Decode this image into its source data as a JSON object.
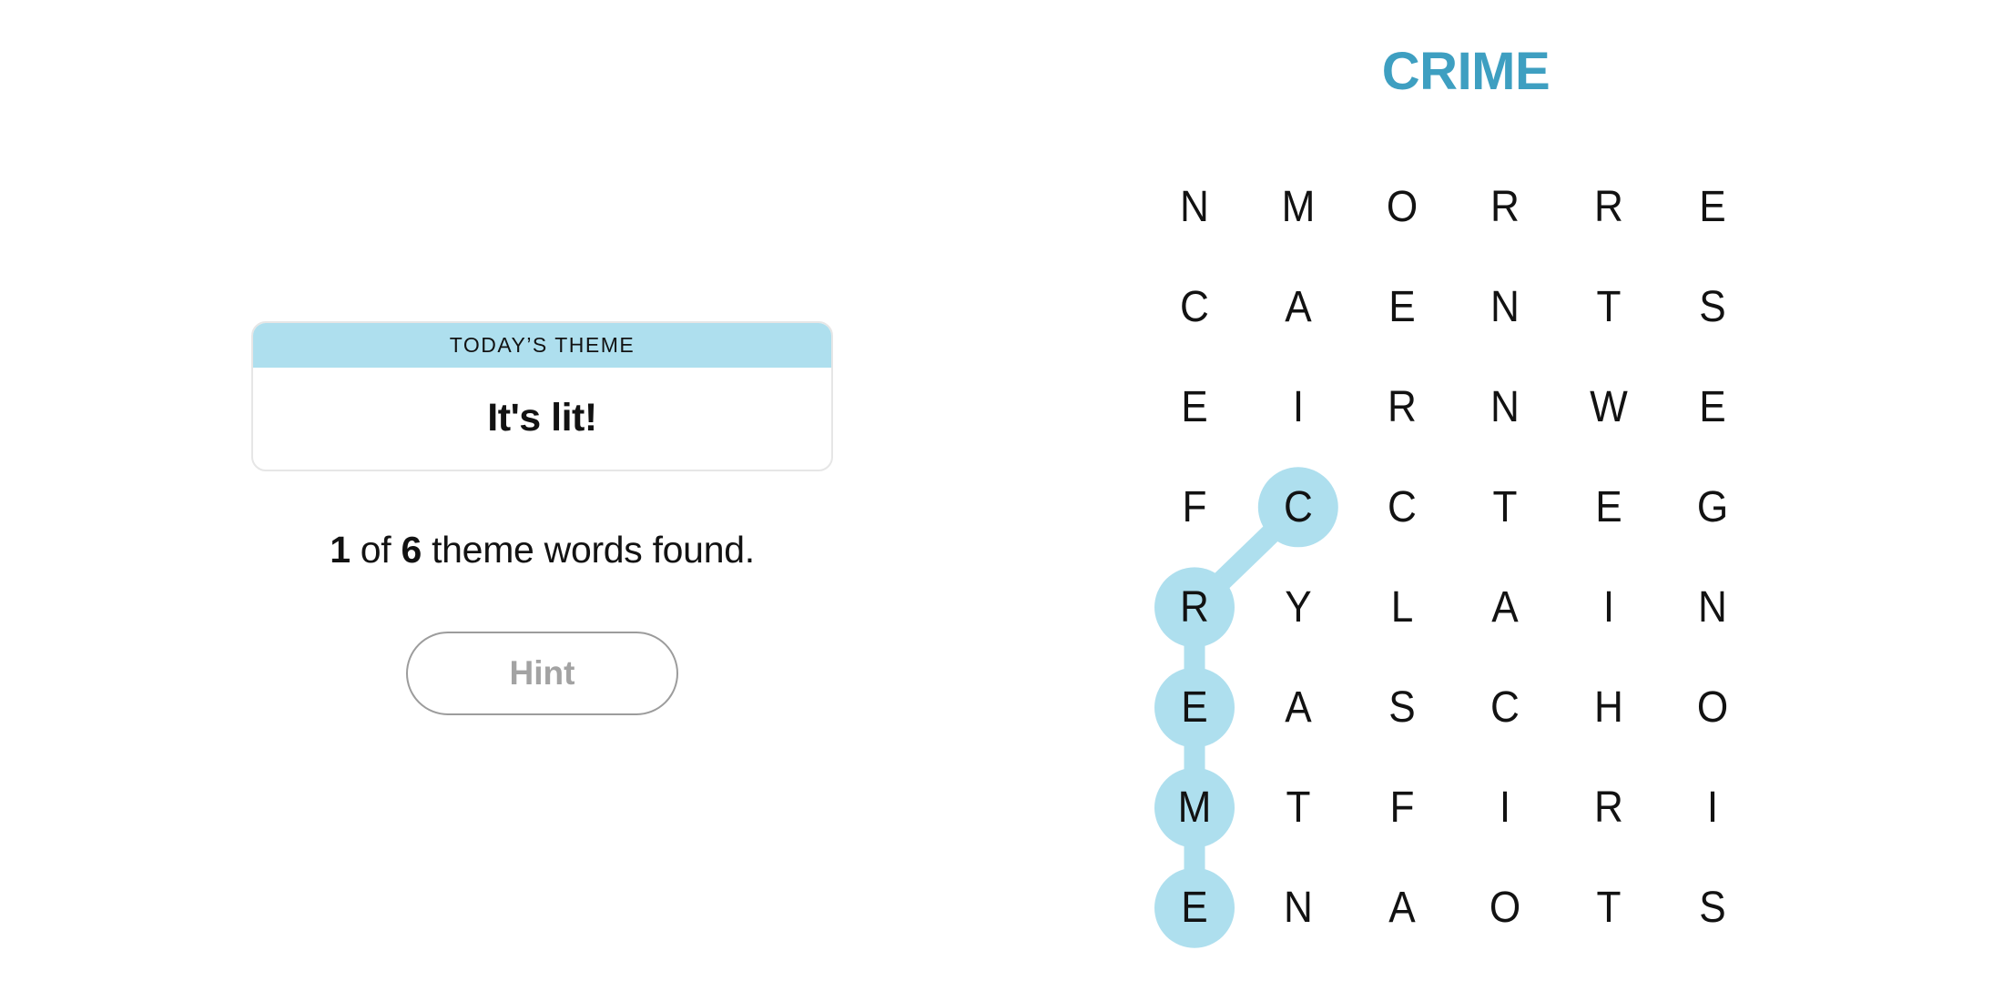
{
  "theme": {
    "header": "TODAY’S THEME",
    "value": "It's lit!"
  },
  "progress": {
    "found": "1",
    "of_label": "of",
    "total": "6",
    "suffix": "theme words found."
  },
  "hint_button": {
    "label": "Hint",
    "state": "disabled"
  },
  "current_word": "CRIME",
  "colors": {
    "highlight": "#aedfee",
    "current_word": "#3e9fc1",
    "hint_text": "#a3a3a3"
  },
  "grid": {
    "rows": [
      [
        "N",
        "M",
        "O",
        "R",
        "R",
        "E"
      ],
      [
        "C",
        "A",
        "E",
        "N",
        "T",
        "S"
      ],
      [
        "E",
        "I",
        "R",
        "N",
        "W",
        "E"
      ],
      [
        "F",
        "C",
        "C",
        "T",
        "E",
        "G"
      ],
      [
        "R",
        "Y",
        "L",
        "A",
        "I",
        "N"
      ],
      [
        "E",
        "A",
        "S",
        "C",
        "H",
        "O"
      ],
      [
        "M",
        "T",
        "F",
        "I",
        "R",
        "I"
      ],
      [
        "E",
        "N",
        "A",
        "O",
        "T",
        "S"
      ]
    ],
    "selected_path": [
      [
        3,
        1
      ],
      [
        4,
        0
      ],
      [
        5,
        0
      ],
      [
        6,
        0
      ],
      [
        7,
        0
      ]
    ]
  }
}
